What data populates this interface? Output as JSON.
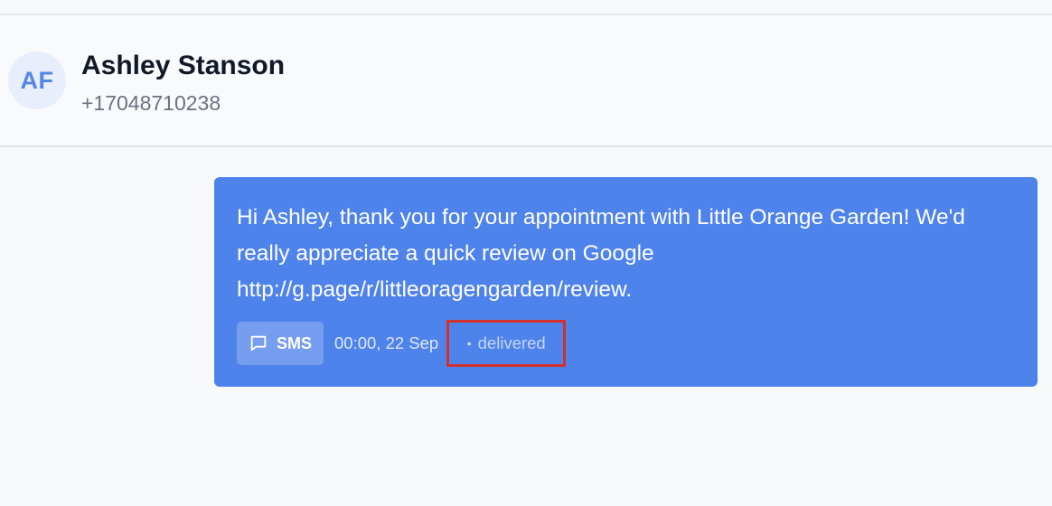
{
  "contact": {
    "initials": "AF",
    "name": "Ashley Stanson",
    "phone": "+17048710238"
  },
  "message": {
    "text": "Hi Ashley, thank you for your appointment with Little Orange Garden! We'd really appreciate a quick review on Google http://g.page/r/littleoragengarden/review.",
    "channel": "SMS",
    "channel_icon": "message-square-icon",
    "timestamp": "00:00, 22 Sep",
    "status_dot": "•",
    "status": "delivered"
  },
  "colors": {
    "bubble": "#4f83ec",
    "avatar_bg": "#e8eefb",
    "avatar_text": "#5587e7",
    "highlight_box": "#d32f2f"
  }
}
